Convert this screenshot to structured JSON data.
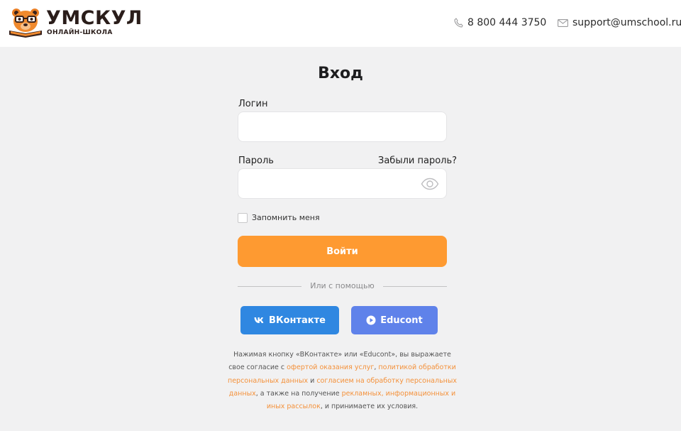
{
  "header": {
    "logo_title": "УМСКУЛ",
    "logo_subtitle": "ОНЛАЙН-ШКОЛА",
    "phone": "8 800 444 3750",
    "email": "support@umschool.ru"
  },
  "form": {
    "title": "Вход",
    "login_label": "Логин",
    "login_value": "",
    "password_label": "Пароль",
    "password_value": "",
    "forgot_link": "Забыли пароль?",
    "remember_label": "Запомнить меня",
    "remember_checked": false,
    "submit_label": "Войти",
    "divider_text": "Или с помощью"
  },
  "social": {
    "vk_label": "ВКонтакте",
    "educont_label": "Educont"
  },
  "consent": {
    "text_1": "Нажимая кнопку «ВКонтакте» или «Educont», вы выражаете свое согласие с ",
    "link_offer": "офертой оказания услуг",
    "text_2": ", ",
    "link_policy": "политикой обработки персональных данных",
    "text_3": " и ",
    "link_consent": "согласием на обработку персональных данных",
    "text_4": ", а также на получение ",
    "link_mailing": "рекламных, информационных и иных рассылок",
    "text_5": ", и принимаете их условия."
  },
  "colors": {
    "accent": "#fe9a31",
    "vk": "#2f87e1",
    "educont": "#5f82ea",
    "link": "#f4913a",
    "background": "#f1f1f2"
  }
}
